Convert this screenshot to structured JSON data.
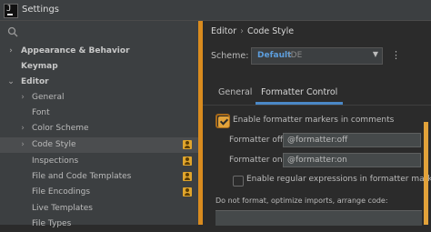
{
  "window": {
    "title": "Settings"
  },
  "sidebar": {
    "items": [
      {
        "label": "Appearance & Behavior",
        "arrow": "›",
        "bold": true,
        "indent": 0,
        "badge": false
      },
      {
        "label": "Keymap",
        "arrow": "",
        "bold": true,
        "indent": 0,
        "badge": false
      },
      {
        "label": "Editor",
        "arrow": "⌄",
        "bold": true,
        "indent": 0,
        "badge": false
      },
      {
        "label": "General",
        "arrow": "›",
        "bold": false,
        "indent": 1,
        "badge": false
      },
      {
        "label": "Font",
        "arrow": "",
        "bold": false,
        "indent": 1,
        "badge": false
      },
      {
        "label": "Color Scheme",
        "arrow": "›",
        "bold": false,
        "indent": 1,
        "badge": false
      },
      {
        "label": "Code Style",
        "arrow": "›",
        "bold": false,
        "indent": 1,
        "badge": true,
        "selected": true
      },
      {
        "label": "Inspections",
        "arrow": "",
        "bold": false,
        "indent": 1,
        "badge": true
      },
      {
        "label": "File and Code Templates",
        "arrow": "",
        "bold": false,
        "indent": 1,
        "badge": true
      },
      {
        "label": "File Encodings",
        "arrow": "",
        "bold": false,
        "indent": 1,
        "badge": true
      },
      {
        "label": "Live Templates",
        "arrow": "",
        "bold": false,
        "indent": 1,
        "badge": false
      },
      {
        "label": "File Types",
        "arrow": "",
        "bold": false,
        "indent": 1,
        "badge": false
      }
    ]
  },
  "breadcrumb": {
    "parts": [
      "Editor",
      "Code Style"
    ],
    "separator": "›"
  },
  "scheme": {
    "label": "Scheme:",
    "value": "Default",
    "suffix": "IDE",
    "caret": "▼",
    "more": "⋮"
  },
  "tabs": [
    "General",
    "Formatter Control"
  ],
  "formatter": {
    "enable_markers": {
      "label": "Enable formatter markers in comments",
      "checked": true
    },
    "off_label": "Formatter off:",
    "off_value": "@formatter:off",
    "on_label": "Formatter on:",
    "on_value": "@formatter:on",
    "regex": {
      "label": "Enable regular expressions in formatter markers",
      "checked": false
    },
    "note": "Do not format, optimize imports, arrange code:"
  },
  "colors": {
    "accent_orange": "#e2a23a",
    "link_blue": "#5c9ede",
    "tab_underline": "#4a88c7"
  }
}
